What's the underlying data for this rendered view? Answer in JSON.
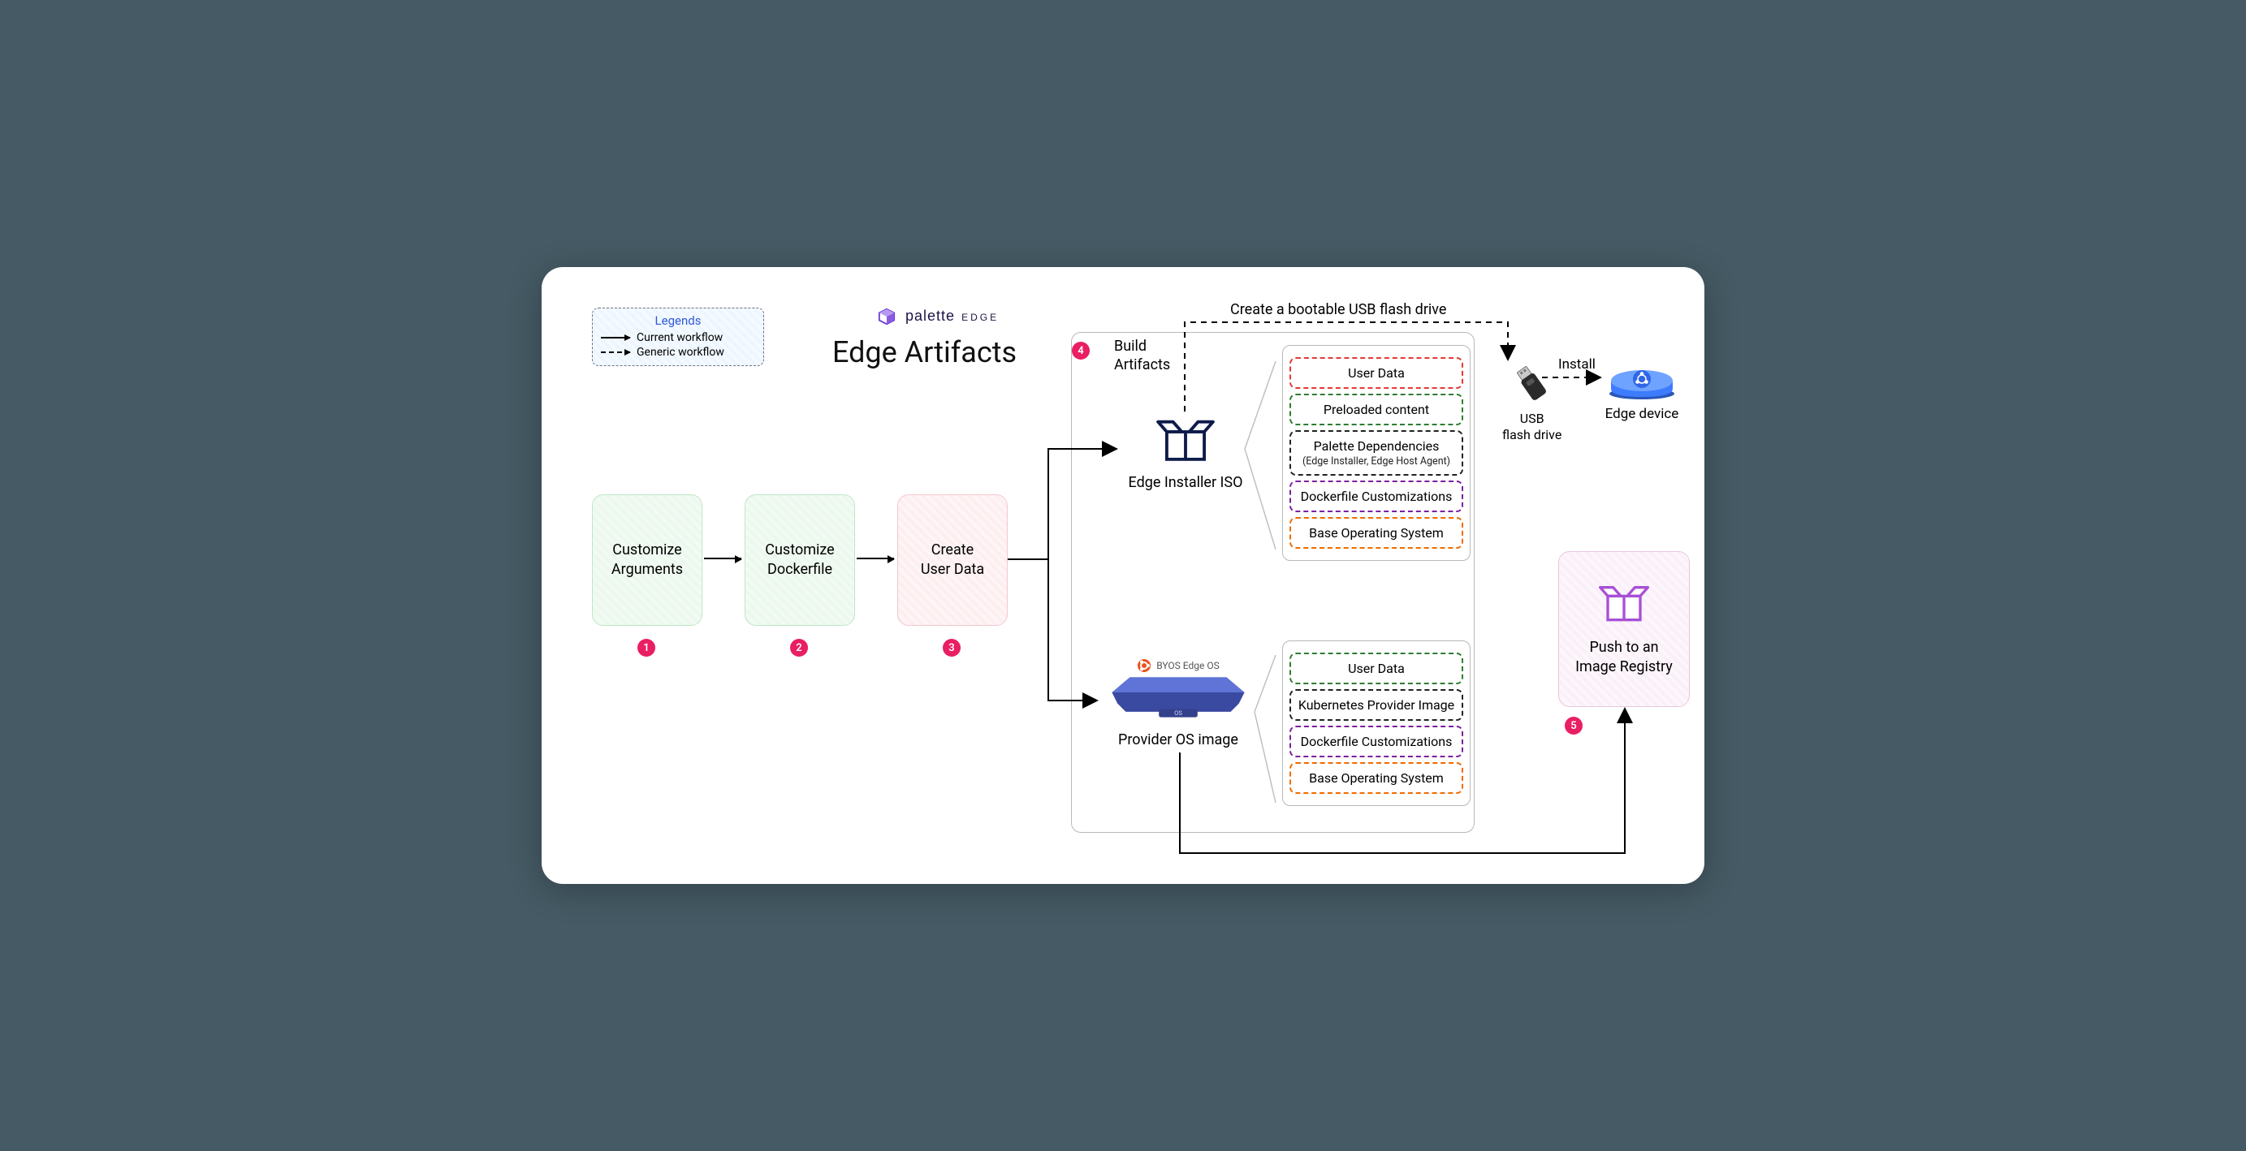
{
  "legend": {
    "title": "Legends",
    "current": "Current workflow",
    "generic": "Generic workflow"
  },
  "brand": {
    "name": "palette",
    "edge": "EDGE"
  },
  "title": "Edge Artifacts",
  "steps": {
    "s1": "Customize\nArguments",
    "s2": "Customize\nDockerfile",
    "s3": "Create\nUser Data",
    "s5": "Push to an\nImage Registry"
  },
  "badges": {
    "b1": "1",
    "b2": "2",
    "b3": "3",
    "b4": "4",
    "b5": "5"
  },
  "build": {
    "label": "Build\nArtifacts"
  },
  "iso": {
    "label": "Edge Installer ISO"
  },
  "os": {
    "label": "Provider OS image",
    "byos": "BYOS Edge OS"
  },
  "stack_iso": {
    "l1": "User Data",
    "l2": "Preloaded content",
    "l3": "Palette Dependencies",
    "l3_sub": "(Edge Installer, Edge Host Agent)",
    "l4": "Dockerfile Customizations",
    "l5": "Base Operating System"
  },
  "stack_os": {
    "l1": "User Data",
    "l2": "Kubernetes Provider Image",
    "l3": "Dockerfile Customizations",
    "l4": "Base Operating System"
  },
  "top_caption": "Create a bootable USB flash drive",
  "usb": {
    "label": "USB\nflash drive"
  },
  "device": {
    "label": "Edge device"
  },
  "install": "Install"
}
